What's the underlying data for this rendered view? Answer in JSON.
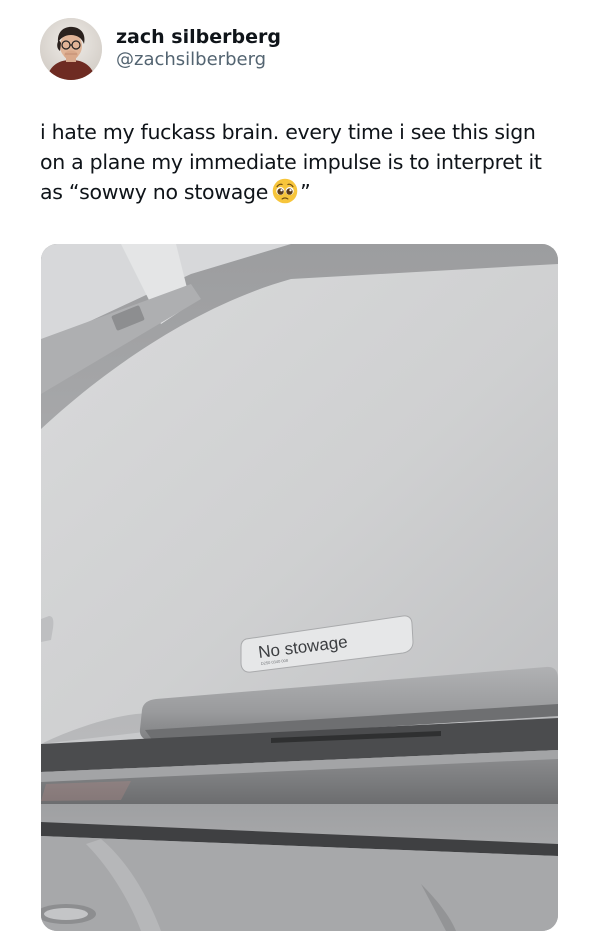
{
  "author": {
    "display_name": "zach silberberg",
    "handle": "@zachsilberberg",
    "avatar_icon": "profile-photo-icon"
  },
  "tweet": {
    "line1": "i hate my fuckass brain. every time i see this sign",
    "line2": "on a plane my immediate impulse is to interpret it",
    "line3_start": "as “sowwy no stowage",
    "line3_end": "”",
    "emoji_name": "pleading-face-emoji"
  },
  "photo": {
    "sign_text": "No stowage",
    "sign_small_print": "D250 0340 008"
  },
  "colors": {
    "text": "#0f1419",
    "secondary_text": "#536471",
    "bin_surface": "#c9cacc",
    "emoji_face": "#f7c53b"
  }
}
